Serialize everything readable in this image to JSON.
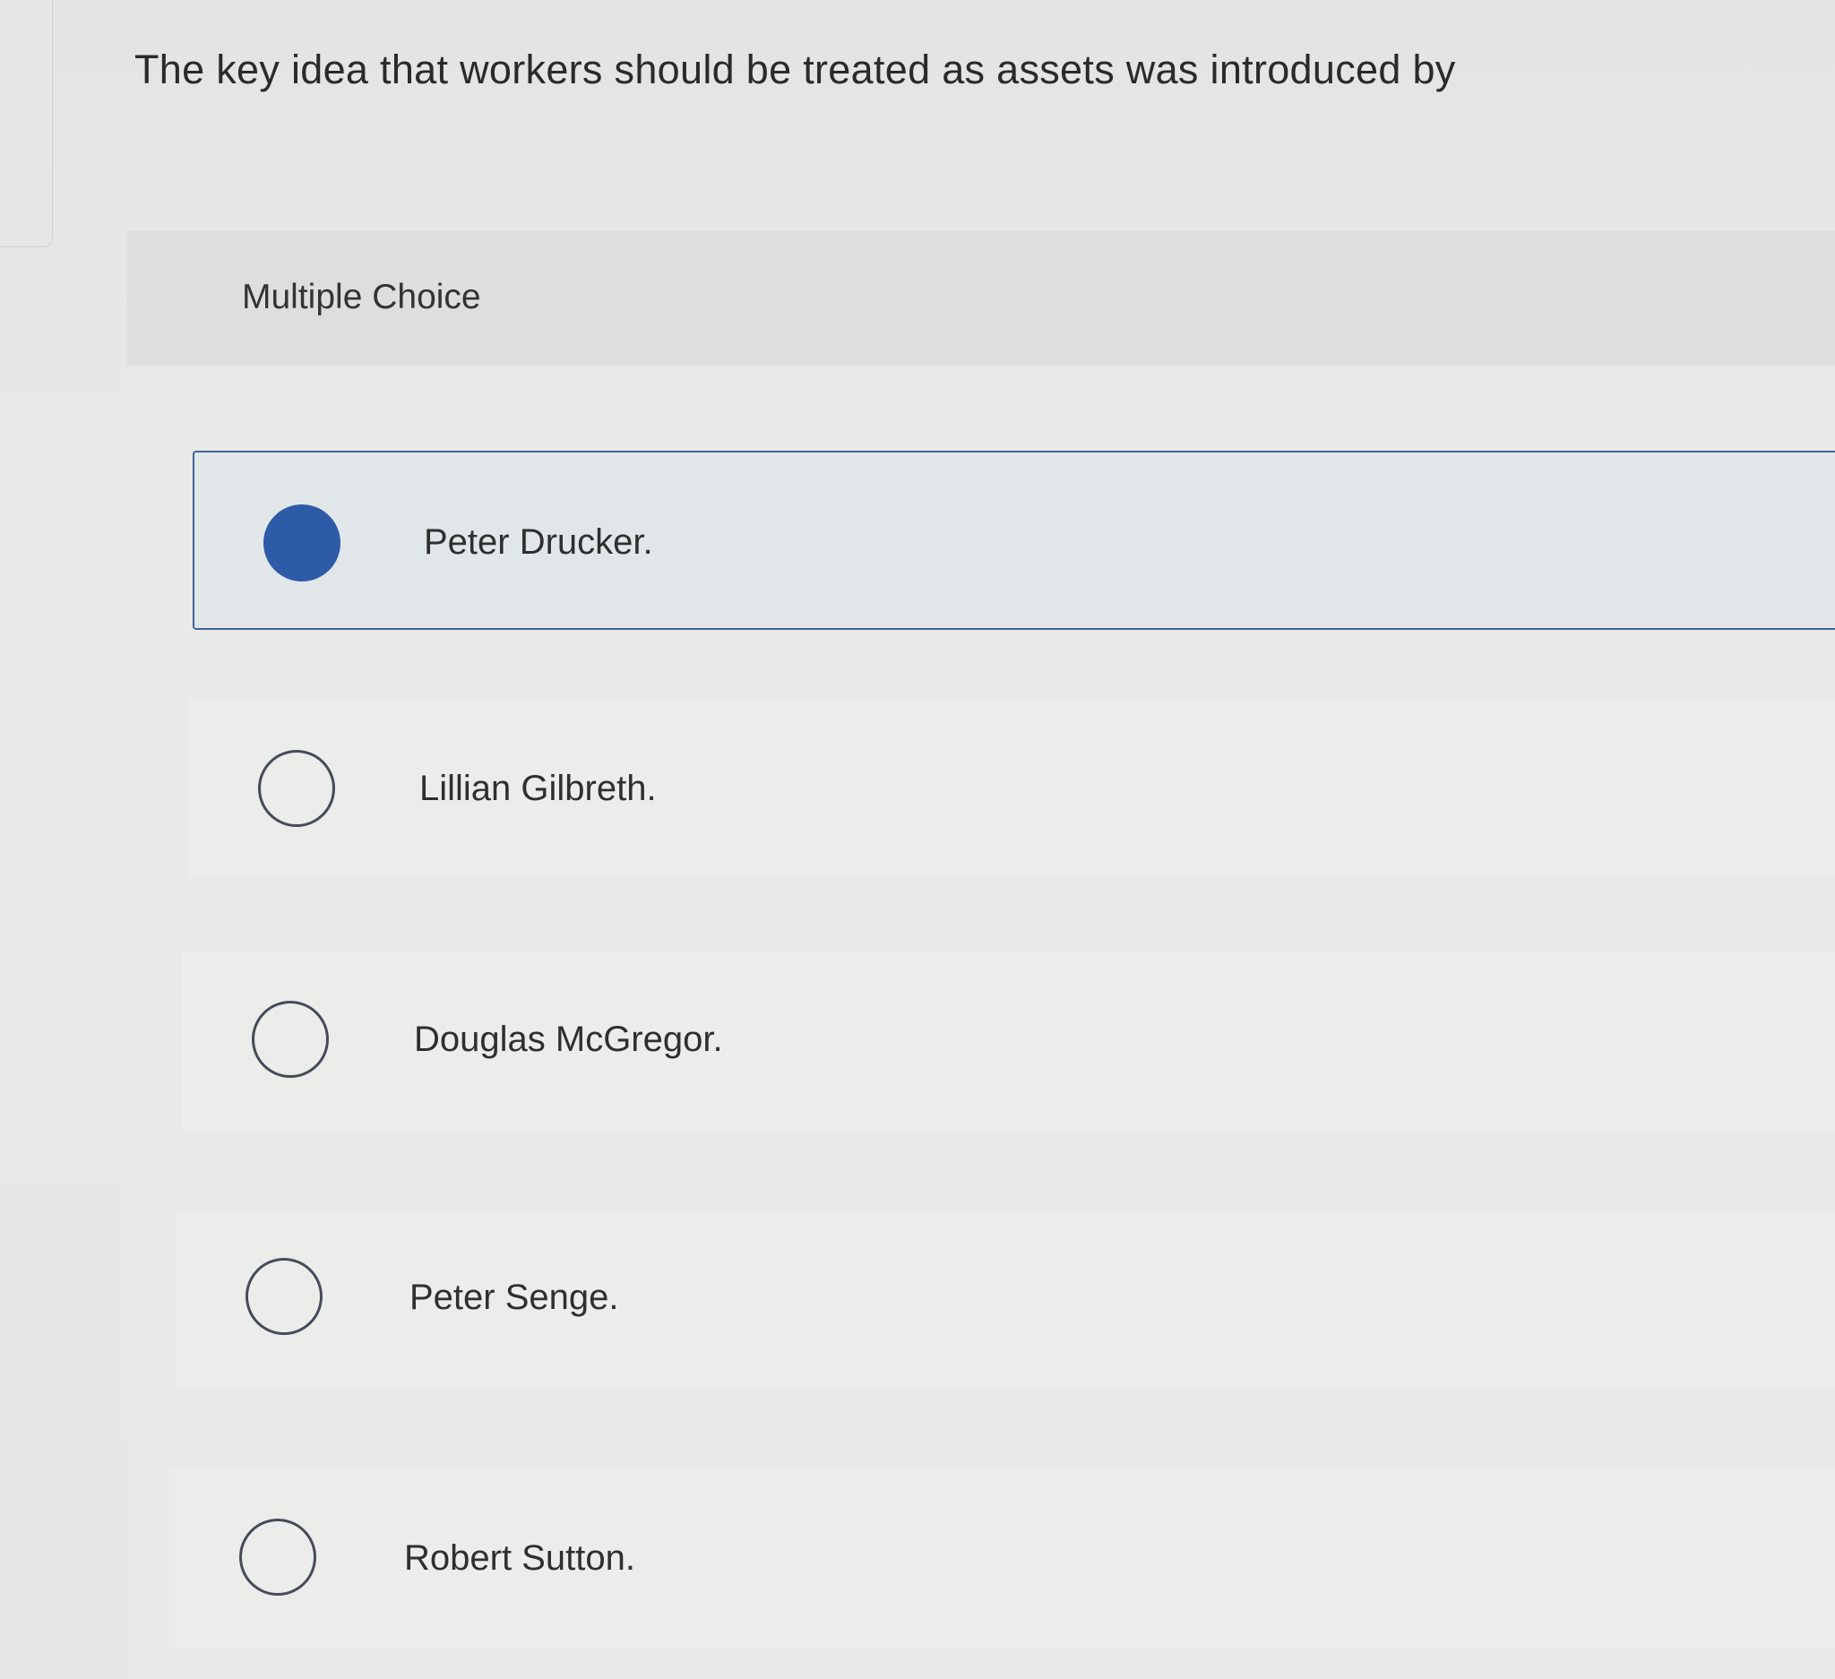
{
  "question": {
    "text": "The key idea that workers should be treated as assets was introduced by"
  },
  "panel": {
    "label": "Multiple Choice"
  },
  "options": [
    {
      "label": "Peter Drucker.",
      "selected": true
    },
    {
      "label": "Lillian Gilbreth.",
      "selected": false
    },
    {
      "label": "Douglas McGregor.",
      "selected": false
    },
    {
      "label": "Peter Senge.",
      "selected": false
    },
    {
      "label": "Robert Sutton.",
      "selected": false
    }
  ],
  "colors": {
    "accent": "#2e5ba8",
    "selected_border": "#41639a",
    "selected_bg": "#e1e7e9"
  },
  "icons": {
    "selected": "radio-filled-icon",
    "unselected": "radio-empty-icon"
  }
}
